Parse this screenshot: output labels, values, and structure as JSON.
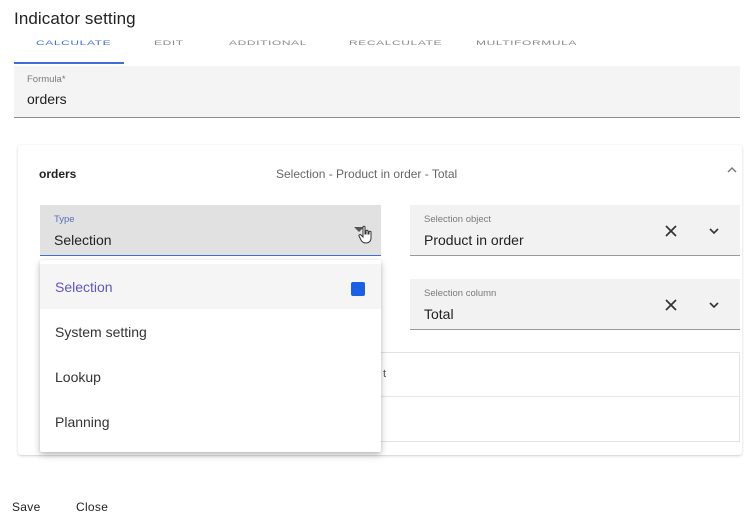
{
  "page": {
    "title": "Indicator setting"
  },
  "tabs": [
    {
      "label": "Calculate",
      "active": true
    },
    {
      "label": "Edit"
    },
    {
      "label": "Additional"
    },
    {
      "label": "Recalculate"
    },
    {
      "label": "Multiformula"
    }
  ],
  "formula": {
    "label": "Formula*",
    "value": "orders"
  },
  "panel": {
    "name": "orders",
    "summary": "Selection - Product in order - Total",
    "type_field": {
      "label": "Type",
      "value": "Selection"
    },
    "selection_object": {
      "label": "Selection object",
      "value": "Product in order"
    },
    "selection_column": {
      "label": "Selection column",
      "value": "Total"
    },
    "hidden_row_tail": "t"
  },
  "type_dropdown": {
    "options": [
      {
        "label": "Selection",
        "selected": true
      },
      {
        "label": "System setting"
      },
      {
        "label": "Lookup"
      },
      {
        "label": "Planning"
      }
    ]
  },
  "footer": {
    "save_label": "Save",
    "close_label": "Close"
  },
  "colors": {
    "accent": "#3f6fd6",
    "selected_text": "#5f55c4",
    "check": "#1c5fe0"
  }
}
